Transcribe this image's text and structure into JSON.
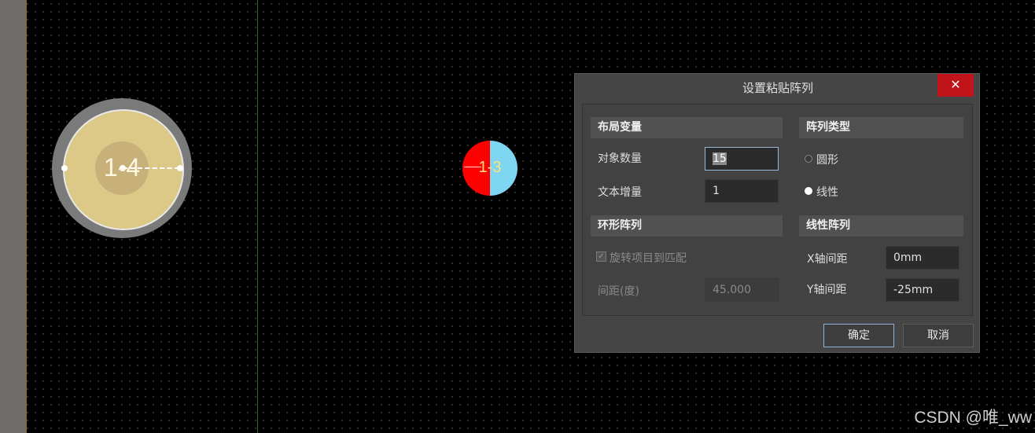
{
  "canvas": {
    "pad_large_label": "1-4",
    "pad_small_label": "1-3"
  },
  "dialog": {
    "title": "设置粘贴阵列",
    "close_symbol": "✕",
    "layout_vars": {
      "header": "布局变量",
      "count_label": "对象数量",
      "count_value": "15",
      "text_inc_label": "文本增量",
      "text_inc_value": "1"
    },
    "array_type": {
      "header": "阵列类型",
      "circular_label": "圆形",
      "linear_label": "线性",
      "selected": "线性"
    },
    "circular_array": {
      "header": "环形阵列",
      "rotate_label": "旋转项目到匹配",
      "rotate_checked": true,
      "spacing_label": "间距(度)",
      "spacing_value": "45.000"
    },
    "linear_array": {
      "header": "线性阵列",
      "x_label": "X轴间距",
      "x_value": "0mm",
      "y_label": "Y轴间距",
      "y_value": "-25mm"
    },
    "ok_label": "确定",
    "cancel_label": "取消"
  },
  "watermark": "CSDN @唯_ww"
}
